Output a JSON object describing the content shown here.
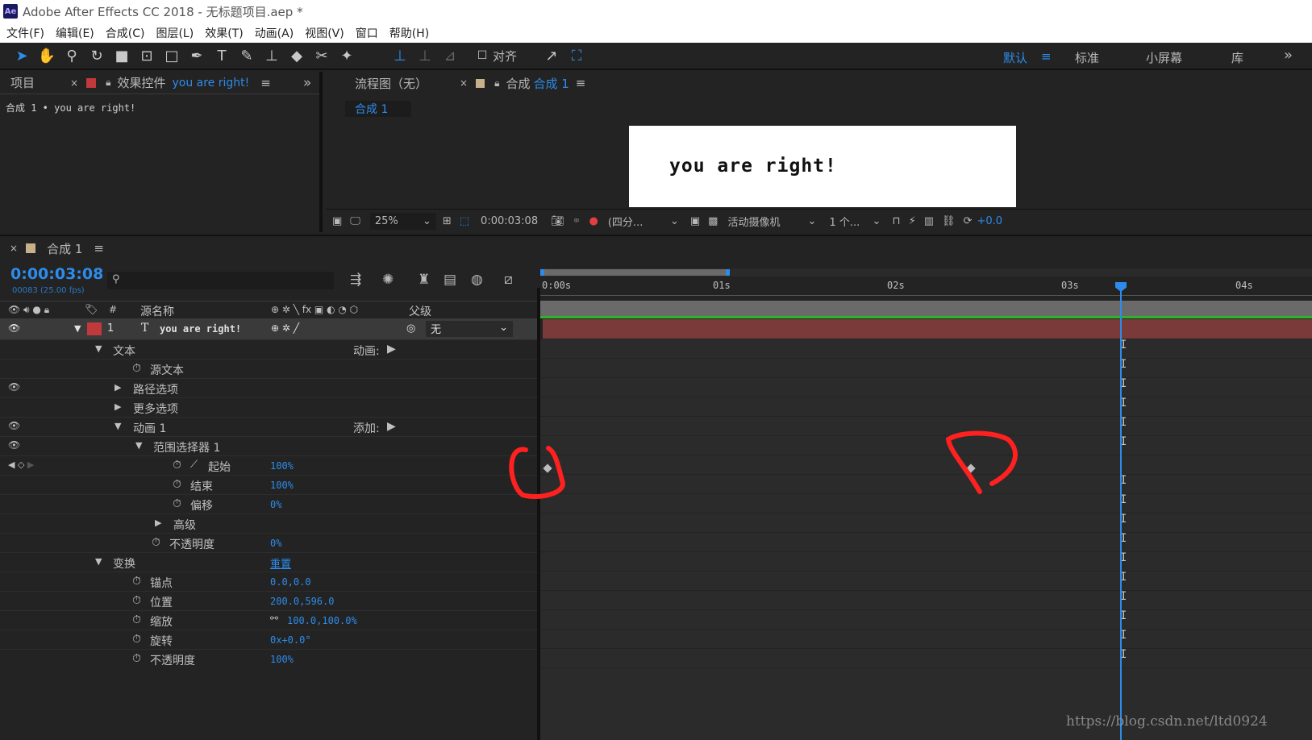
{
  "window": {
    "title": "Adobe After Effects CC 2018 - 无标题项目.aep *",
    "app_icon": "Ae"
  },
  "menu": [
    "文件(F)",
    "编辑(E)",
    "合成(C)",
    "图层(L)",
    "效果(T)",
    "动画(A)",
    "视图(V)",
    "窗口",
    "帮助(H)"
  ],
  "toolbar": {
    "align_label": "对齐",
    "workspaces": [
      "默认",
      "标准",
      "小屏幕",
      "库"
    ],
    "more": "»"
  },
  "project_panel": {
    "tab_project": "项目",
    "tab_effects": "效果控件",
    "tab_effects_layer": "you are right!",
    "info": "合成 1 • you are right!"
  },
  "comp_panel": {
    "tab_flowchart": "流程图（无）",
    "tab_comp_prefix": "合成",
    "tab_comp_name": "合成 1",
    "breadcrumb": "合成 1",
    "preview_text": "you are right!",
    "zoom": "25%",
    "timecode": "0:00:03:08",
    "resolution": "(四分...",
    "camera": "活动摄像机",
    "views": "1 个...",
    "exposure": "+0.0"
  },
  "timeline": {
    "tab": "合成 1",
    "timecode": "0:00:03:08",
    "frame_info": "00083 (25.00 fps)",
    "search_placeholder": "",
    "col_source": "源名称",
    "col_num": "#",
    "col_parent": "父级",
    "layer": {
      "num": "1",
      "type": "T",
      "name": "you are right!",
      "parent": "无"
    },
    "ruler": [
      "0:00s",
      "01s",
      "02s",
      "03s",
      "04s"
    ],
    "current_time_marker": "03s+08f",
    "props": [
      {
        "label": "文本",
        "extra_label": "动画:"
      },
      {
        "label": "源文本"
      },
      {
        "label": "路径选项"
      },
      {
        "label": "更多选项"
      },
      {
        "label": "动画 1",
        "extra_label": "添加:"
      },
      {
        "label": "范围选择器 1"
      },
      {
        "label": "起始",
        "value": "100%"
      },
      {
        "label": "结束",
        "value": "100%"
      },
      {
        "label": "偏移",
        "value": "0%"
      },
      {
        "label": "高级"
      },
      {
        "label": "不透明度",
        "value": "0%"
      },
      {
        "label": "变换",
        "value": "重置"
      },
      {
        "label": "锚点",
        "value": "0.0,0.0"
      },
      {
        "label": "位置",
        "value": "200.0,596.0"
      },
      {
        "label": "缩放",
        "value": "100.0,100.0%"
      },
      {
        "label": "旋转",
        "value": "0x+0.0°"
      },
      {
        "label": "不透明度",
        "value": "100%"
      }
    ],
    "keyframes_seconds": [
      0.0,
      2.52
    ],
    "annotation_color": "#ff0000"
  },
  "watermark": "https://blog.csdn.net/ltd0924",
  "colors": {
    "accent": "#2d8ceb",
    "layer_label": "#c0393b",
    "track_bar": "#7a3a3a",
    "playhead": "#2d8ceb"
  }
}
